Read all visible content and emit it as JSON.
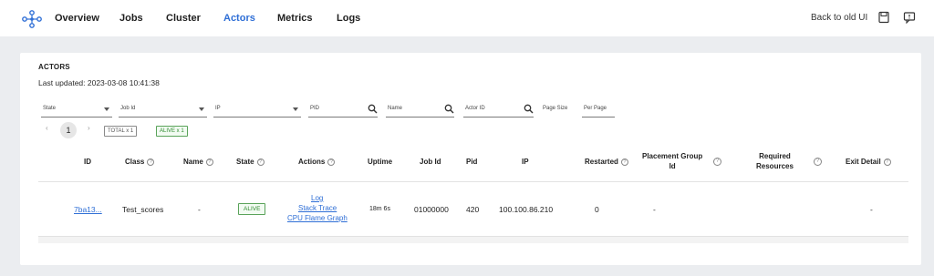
{
  "nav": {
    "items": [
      {
        "label": "Overview",
        "active": false
      },
      {
        "label": "Jobs",
        "active": false
      },
      {
        "label": "Cluster",
        "active": false
      },
      {
        "label": "Actors",
        "active": true
      },
      {
        "label": "Metrics",
        "active": false
      },
      {
        "label": "Logs",
        "active": false
      }
    ],
    "back_label": "Back to old UI",
    "icons": [
      "docs-icon",
      "feedback-icon"
    ]
  },
  "colors": {
    "accent": "#2f6fd6",
    "alive": "#2f8a2f",
    "background": "#ebedf0"
  },
  "section": {
    "title": "ACTORS",
    "last_updated": "Last updated: 2023-03-08 10:41:38"
  },
  "filters": {
    "state": "State",
    "job_id": "Job Id",
    "ip": "IP",
    "pid": "PID",
    "name": "Name",
    "actor_id": "Actor ID",
    "page_size": "Page Size",
    "per_page": "Per Page"
  },
  "pagination": {
    "prev": "‹",
    "current": "1",
    "next": "›",
    "total_badge": "TOTAL x 1",
    "alive_badge": "ALIVE x 1"
  },
  "table": {
    "headers": {
      "id": "ID",
      "class": "Class",
      "name": "Name",
      "state": "State",
      "actions": "Actions",
      "uptime": "Uptime",
      "job_id": "Job Id",
      "pid": "Pid",
      "ip": "IP",
      "restarted": "Restarted",
      "placement_line1": "Placement Group",
      "placement_line2": "Id",
      "required_line1": "Required",
      "required_line2": "Resources",
      "exit_detail": "Exit Detail"
    },
    "help_glyph": "?",
    "rows": [
      {
        "id": "7ba13...",
        "class": "Test_scores",
        "name": "-",
        "state": "ALIVE",
        "action_log": "Log",
        "action_stack": "Stack Trace",
        "action_flame": "CPU Flame Graph",
        "uptime": "18m 6s",
        "job_id": "01000000",
        "pid": "420",
        "ip": "100.100.86.210",
        "restarted": "0",
        "placement_group": "-",
        "required_resources": "",
        "exit_detail": "-"
      }
    ]
  }
}
